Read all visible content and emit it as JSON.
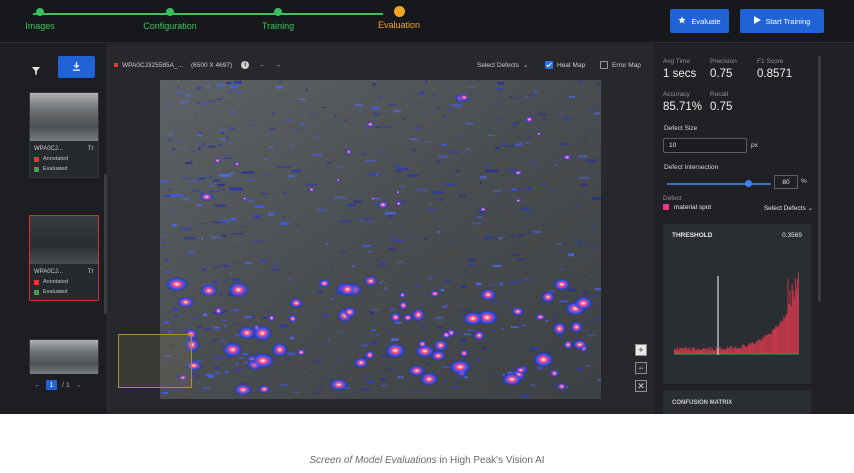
{
  "stepper": {
    "steps": [
      {
        "label": "Images",
        "state": "done"
      },
      {
        "label": "Configuration",
        "state": "done"
      },
      {
        "label": "Training",
        "state": "done"
      },
      {
        "label": "Evaluation",
        "state": "active"
      }
    ]
  },
  "header": {
    "evaluate_label": "Evaluate",
    "start_training_label": "Start Training"
  },
  "sidebar": {
    "cards": [
      {
        "name": "WPA0CJ...",
        "type_icon": "Tт",
        "annotated_label": "Annotated",
        "evaluated_label": "Evaluated"
      },
      {
        "name": "WPA0CJ...",
        "type_icon": "Tт",
        "annotated_label": "Annotated",
        "evaluated_label": "Evaluated"
      }
    ],
    "pager": {
      "current": "1",
      "total": "/ 1"
    }
  },
  "viewer": {
    "file_name": "WPA0CJ325585A_...",
    "dimensions": "(6500 X 4697)",
    "select_defects_label": "Select Defects",
    "heat_map_label": "Heat Map",
    "heat_map_checked": true,
    "error_map_label": "Error Map",
    "error_map_checked": false,
    "zoom_in": "+",
    "zoom_out": "−",
    "reset": "✕"
  },
  "metrics": [
    {
      "key": "Avg Time",
      "value": "1 secs"
    },
    {
      "key": "Precision",
      "value": "0.75"
    },
    {
      "key": "F1 Score",
      "value": "0.8571"
    },
    {
      "key": "Accuracy",
      "value": "85.71%"
    },
    {
      "key": "Recall",
      "value": "0.75"
    }
  ],
  "settings": {
    "defect_size_label": "Defect Size",
    "defect_size_value": "10",
    "defect_size_unit": "px",
    "intersection_label": "Defect Intersection",
    "intersection_value": "80",
    "intersection_unit": "%",
    "intersection_fraction": 0.8,
    "defect_label": "Defect",
    "defect_name": "material spot",
    "select_defects_label": "Select Defects"
  },
  "threshold": {
    "title": "THRESHOLD",
    "value": "0.3569"
  },
  "confusion_matrix": {
    "title": "CONFUSION MATRIX"
  },
  "caption": {
    "italic": "Screen of Model Evaluations",
    "rest": " in High Peak's Vision AI"
  },
  "colors": {
    "accent_blue": "#1f63d6",
    "step_done": "#39c15a",
    "step_active": "#f5a623",
    "annotated": "#e53935",
    "evaluated": "#43a047",
    "defect_pink": "#e8358e"
  }
}
